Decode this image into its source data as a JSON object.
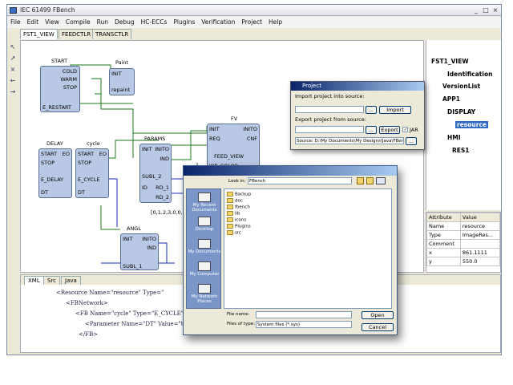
{
  "window": {
    "title": "IEC 61499 FBench"
  },
  "menu": [
    "File",
    "Edit",
    "View",
    "Compile",
    "Run",
    "Debug",
    "HC-ECCs",
    "Plugins",
    "Verification",
    "Project",
    "Help"
  ],
  "tabs": [
    "FST1_VIEW",
    "FEEDCTLR",
    "TRANSCTLR"
  ],
  "canvas": {
    "blocks": {
      "start": {
        "name": "START",
        "pins": [
          "COLD",
          "WARM",
          "STOP",
          "E_RESTART"
        ]
      },
      "paint": {
        "name": "Paint",
        "pins": [
          "INIT",
          "repaint"
        ]
      },
      "delay": {
        "name": "DELAY",
        "pins": [
          "START",
          "EO",
          "STOP",
          "E_DELAY",
          "DT"
        ]
      },
      "cycle": {
        "name": "cycle",
        "pins": [
          "START",
          "EO",
          "STOP",
          "E_CYCLE",
          "DT"
        ]
      },
      "params": {
        "name": "PARAMS",
        "pins": [
          "INIT",
          "INITO",
          "IND",
          "SUBL_2",
          "ID",
          "RD_1",
          "RD_2"
        ]
      },
      "fv": {
        "name": "FV",
        "pins": [
          "INIT",
          "INITO",
          "REQ",
          "CNF",
          "FEED_VIEW",
          "WP_COLOR",
          "1"
        ]
      },
      "angl": {
        "name": "ANGL",
        "pins": [
          "INIT",
          "INITO",
          "IND",
          "SUBL_1"
        ]
      }
    },
    "literals": [
      "100",
      "950",
      "[0,1,2,3,0,0,0,0,0]"
    ]
  },
  "tree": {
    "root": "FST1_VIEW",
    "nodes": [
      "Identification",
      "VersionList",
      "APP1",
      "DISPLAY",
      "resource",
      "HMI",
      "RES1"
    ]
  },
  "props": {
    "headers": [
      "Attribute",
      "Value"
    ],
    "rows": [
      [
        "Name",
        "resource"
      ],
      [
        "Type",
        "ImageRes..."
      ],
      [
        "Comment",
        ""
      ],
      [
        "x",
        "861.1111"
      ],
      [
        "y",
        "550.0"
      ]
    ]
  },
  "bottom": {
    "tabs": [
      "XML",
      "Src",
      "Java"
    ],
    "xml_lines": [
      "<Resource Name=\"resource\" Type=\"",
      "<FBNetwork>",
      "<FB Name=\"cycle\" Type=\"E_CYCLE\" x",
      "<Parameter Name=\"DT\" Value=\"t#100ms\"/>",
      "</FB>"
    ]
  },
  "project_dialog": {
    "title": "Project",
    "import_label": "Import project into source:",
    "export_label": "Export project from source:",
    "browse": "...",
    "import_btn": "Import",
    "export_btn": "Export",
    "jar_label": "JAR",
    "source_label": "Source: D:\\My Documents\\My Designs\\Java\\FBench\\Project\\"
  },
  "file_dialog": {
    "look_in": "Look in:",
    "look_in_value": "FBench",
    "places": [
      "My Recent Documents",
      "Desktop",
      "My Documents",
      "My Computer",
      "My Network Places"
    ],
    "files": [
      "Backup",
      "doc",
      "fbench",
      "lib",
      "icons",
      "Plugins",
      "src"
    ],
    "file_name_label": "File name:",
    "files_type_label": "Files of type:",
    "files_type_value": "System files (*.sys)",
    "open_btn": "Open",
    "cancel_btn": "Cancel"
  }
}
